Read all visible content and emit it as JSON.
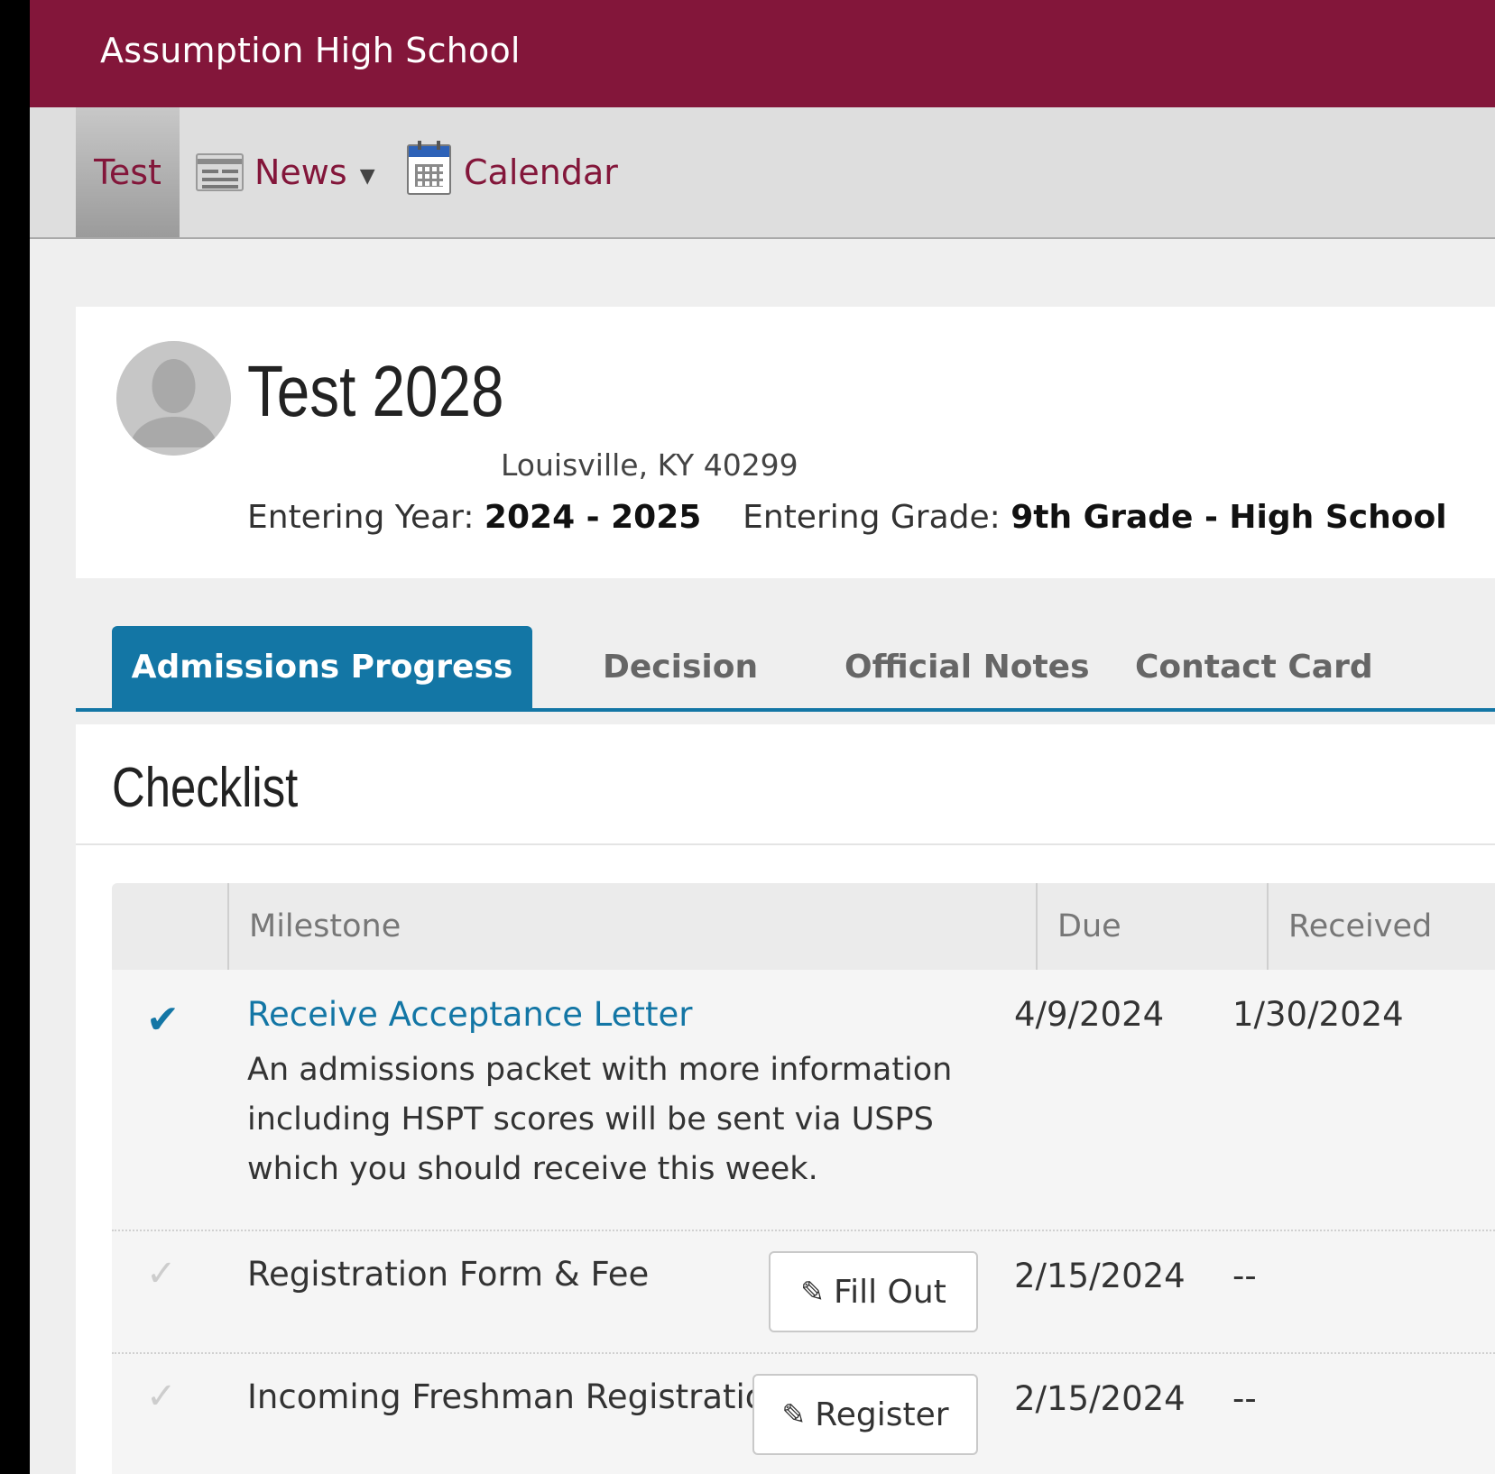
{
  "header": {
    "school_name": "Assumption High School"
  },
  "nav": {
    "items": [
      {
        "label": "Test"
      },
      {
        "label": "News",
        "icon": "newspaper-icon",
        "has_dropdown": true
      },
      {
        "label": "Calendar",
        "icon": "calendar-icon"
      }
    ]
  },
  "profile": {
    "name": "Test 2028",
    "location": "Louisville, KY 40299",
    "entering_year_label": "Entering Year:",
    "entering_year": "2024 - 2025",
    "entering_grade_label": "Entering Grade:",
    "entering_grade": "9th Grade - High School"
  },
  "tabs": [
    {
      "label": "Admissions Progress",
      "active": true
    },
    {
      "label": "Decision"
    },
    {
      "label": "Official Notes"
    },
    {
      "label": "Contact Card"
    }
  ],
  "checklist": {
    "title": "Checklist",
    "columns": [
      "Milestone",
      "Due",
      "Received"
    ],
    "rows": [
      {
        "status": "complete",
        "milestone": "Receive Acceptance Letter",
        "description": "An admissions packet with more information including HSPT scores will be sent via USPS which you should receive this week.",
        "due": "4/9/2024",
        "received": "1/30/2024"
      },
      {
        "status": "incomplete",
        "milestone": "Registration Form & Fee",
        "action": "Fill Out",
        "due": "2/15/2024",
        "received": "--"
      },
      {
        "status": "incomplete",
        "milestone": "Incoming Freshman Registration",
        "action": "Register",
        "due": "2/15/2024",
        "received": "--"
      }
    ]
  },
  "colors": {
    "brand": "#83163a",
    "accent": "#1376a5"
  }
}
